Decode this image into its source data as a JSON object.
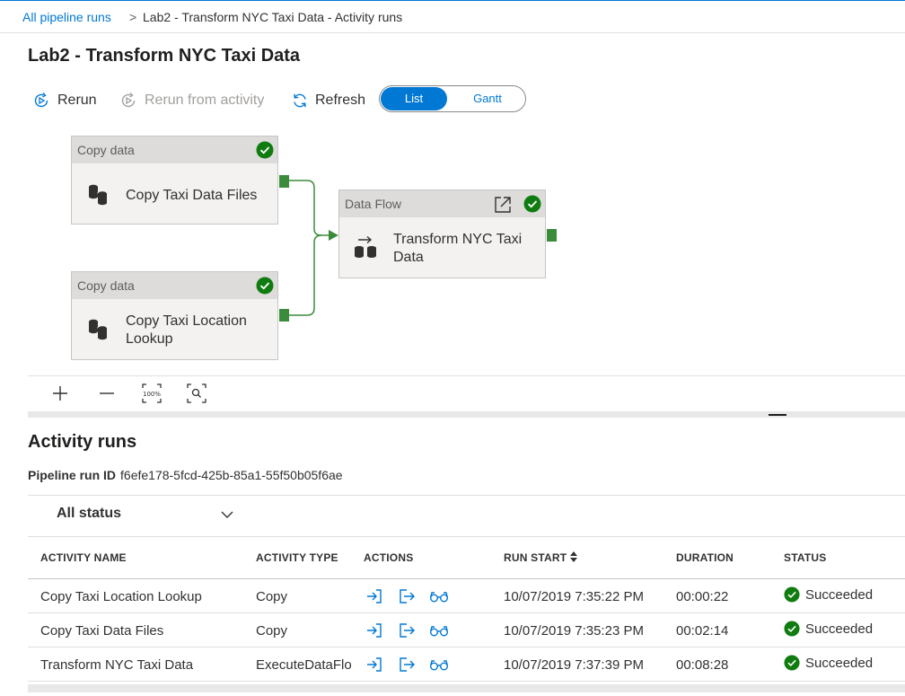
{
  "breadcrumb": {
    "root_link": "All pipeline runs",
    "separator": ">",
    "current": "Lab2 - Transform NYC Taxi Data - Activity runs"
  },
  "page_title": "Lab2 - Transform NYC Taxi Data",
  "toolbar": {
    "rerun": "Rerun",
    "rerun_from_activity": "Rerun from activity",
    "refresh": "Refresh",
    "view_toggle": {
      "list": "List",
      "gantt": "Gantt",
      "selected": "List"
    }
  },
  "canvas": {
    "nodes": [
      {
        "type": "Copy data",
        "name": "Copy Taxi Data Files",
        "status": "succeeded",
        "icon": "copy-data-icon"
      },
      {
        "type": "Copy data",
        "name": "Copy Taxi Location Lookup",
        "status": "succeeded",
        "icon": "copy-data-icon"
      },
      {
        "type": "Data Flow",
        "name": "Transform NYC Taxi Data",
        "status": "succeeded",
        "icon": "data-flow-icon"
      }
    ],
    "zoom_controls": [
      "zoom-in-icon",
      "zoom-out-icon",
      "zoom-100-icon",
      "zoom-fit-icon"
    ]
  },
  "activity_runs": {
    "title": "Activity runs",
    "pipeline_run_label": "Pipeline run ID",
    "pipeline_run_id": "f6efe178-5fcd-425b-85a1-55f50b05f6ae",
    "filter": "All status",
    "columns": [
      "ACTIVITY NAME",
      "ACTIVITY TYPE",
      "ACTIONS",
      "RUN START",
      "DURATION",
      "STATUS"
    ],
    "rows": [
      {
        "name": "Copy Taxi Location Lookup",
        "type": "Copy",
        "run_start": "10/07/2019 7:35:22 PM",
        "duration": "00:00:22",
        "status": "Succeeded"
      },
      {
        "name": "Copy Taxi Data Files",
        "type": "Copy",
        "run_start": "10/07/2019 7:35:23 PM",
        "duration": "00:02:14",
        "status": "Succeeded"
      },
      {
        "name": "Transform NYC Taxi Data",
        "type": "ExecuteDataFlo",
        "run_start": "10/07/2019 7:37:39 PM",
        "duration": "00:08:28",
        "status": "Succeeded"
      }
    ]
  },
  "colors": {
    "accent": "#0078d4",
    "success": "#107c10",
    "port": "#3a8c3a"
  }
}
